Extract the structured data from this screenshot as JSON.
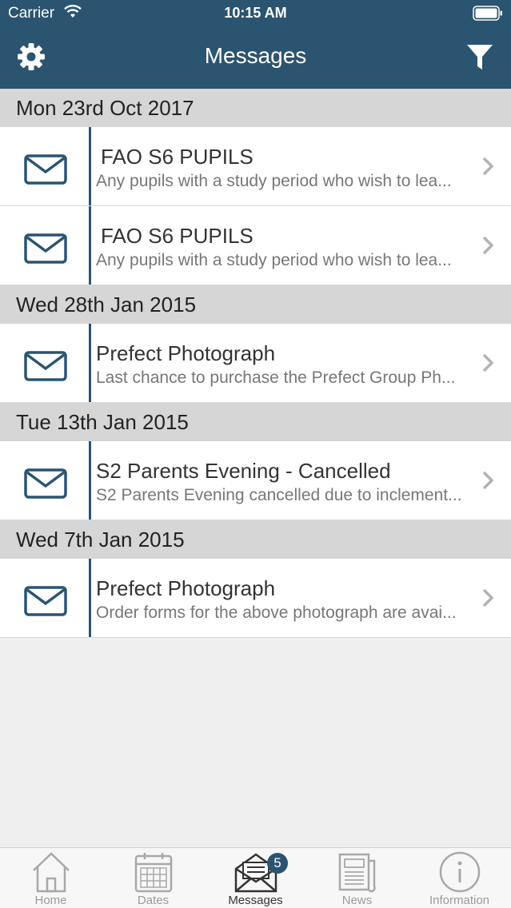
{
  "status": {
    "carrier": "Carrier",
    "time": "10:15 AM"
  },
  "nav": {
    "title": "Messages"
  },
  "colors": {
    "primary": "#2b5470",
    "section": "#d6d6d6",
    "background": "#efefef"
  },
  "sections": [
    {
      "header": "Mon 23rd Oct 2017",
      "items": [
        {
          "title": "FAO S6 PUPILS",
          "subtitle": "Any pupils with a study period who wish to lea..."
        },
        {
          "title": "FAO S6 PUPILS",
          "subtitle": "Any pupils with a study period who wish to lea..."
        }
      ]
    },
    {
      "header": "Wed 28th Jan 2015",
      "items": [
        {
          "title": "Prefect Photograph",
          "subtitle": "Last chance to purchase the Prefect Group Ph..."
        }
      ]
    },
    {
      "header": "Tue 13th Jan 2015",
      "items": [
        {
          "title": "S2 Parents Evening - Cancelled",
          "subtitle": "S2 Parents Evening cancelled due to inclement..."
        }
      ]
    },
    {
      "header": "Wed 7th Jan 2015",
      "items": [
        {
          "title": "Prefect Photograph",
          "subtitle": "Order forms for the above photograph are avai..."
        }
      ]
    }
  ],
  "tabs": [
    {
      "label": "Home",
      "icon": "home-icon"
    },
    {
      "label": "Dates",
      "icon": "calendar-icon"
    },
    {
      "label": "Messages",
      "icon": "envelope-icon",
      "badge": "5"
    },
    {
      "label": "News",
      "icon": "newspaper-icon"
    },
    {
      "label": "Information",
      "icon": "info-icon"
    }
  ]
}
